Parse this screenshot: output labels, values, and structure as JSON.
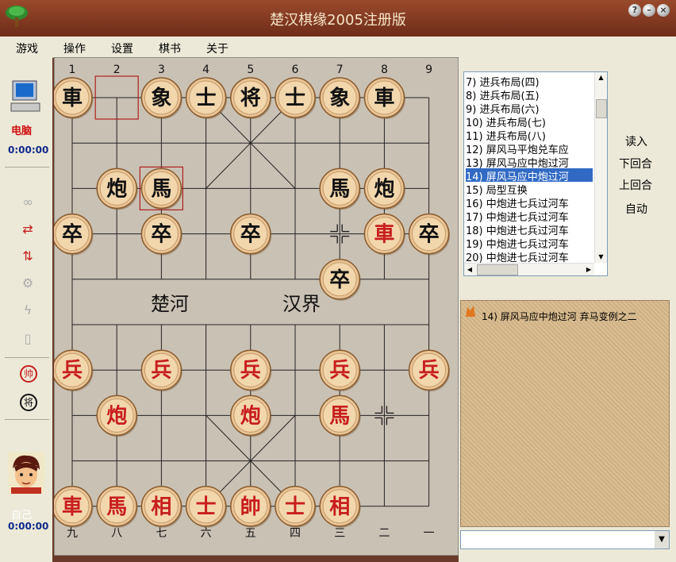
{
  "window": {
    "title": "楚汉棋缘2005注册版"
  },
  "menu": [
    "游戏",
    "操作",
    "设置",
    "棋书",
    "关于"
  ],
  "board": {
    "top_labels": [
      "1",
      "2",
      "3",
      "4",
      "5",
      "6",
      "7",
      "8",
      "9"
    ],
    "bottom_labels": [
      "九",
      "八",
      "七",
      "六",
      "五",
      "四",
      "三",
      "二",
      "一"
    ],
    "river_left": "楚河",
    "river_right": "汉界",
    "pieces": [
      {
        "char": "車",
        "side": "black",
        "col": 0,
        "row": 0
      },
      {
        "char": "象",
        "side": "black",
        "col": 2,
        "row": 0
      },
      {
        "char": "士",
        "side": "black",
        "col": 3,
        "row": 0
      },
      {
        "char": "将",
        "side": "black",
        "col": 4,
        "row": 0
      },
      {
        "char": "士",
        "side": "black",
        "col": 5,
        "row": 0
      },
      {
        "char": "象",
        "side": "black",
        "col": 6,
        "row": 0
      },
      {
        "char": "車",
        "side": "black",
        "col": 7,
        "row": 0
      },
      {
        "char": "炮",
        "side": "black",
        "col": 1,
        "row": 2
      },
      {
        "char": "馬",
        "side": "black",
        "col": 2,
        "row": 2
      },
      {
        "char": "馬",
        "side": "black",
        "col": 6,
        "row": 2
      },
      {
        "char": "炮",
        "side": "black",
        "col": 7,
        "row": 2
      },
      {
        "char": "卒",
        "side": "black",
        "col": 0,
        "row": 3
      },
      {
        "char": "卒",
        "side": "black",
        "col": 2,
        "row": 3
      },
      {
        "char": "卒",
        "side": "black",
        "col": 4,
        "row": 3
      },
      {
        "char": "車",
        "side": "red",
        "col": 7,
        "row": 3
      },
      {
        "char": "卒",
        "side": "black",
        "col": 8,
        "row": 3
      },
      {
        "char": "卒",
        "side": "black",
        "col": 6,
        "row": 4
      },
      {
        "char": "兵",
        "side": "red",
        "col": 0,
        "row": 6
      },
      {
        "char": "兵",
        "side": "red",
        "col": 2,
        "row": 6
      },
      {
        "char": "兵",
        "side": "red",
        "col": 4,
        "row": 6
      },
      {
        "char": "兵",
        "side": "red",
        "col": 6,
        "row": 6
      },
      {
        "char": "兵",
        "side": "red",
        "col": 8,
        "row": 6
      },
      {
        "char": "炮",
        "side": "red",
        "col": 1,
        "row": 7
      },
      {
        "char": "炮",
        "side": "red",
        "col": 4,
        "row": 7
      },
      {
        "char": "馬",
        "side": "red",
        "col": 6,
        "row": 7
      },
      {
        "char": "車",
        "side": "red",
        "col": 0,
        "row": 9
      },
      {
        "char": "馬",
        "side": "red",
        "col": 1,
        "row": 9
      },
      {
        "char": "相",
        "side": "red",
        "col": 2,
        "row": 9
      },
      {
        "char": "士",
        "side": "red",
        "col": 3,
        "row": 9
      },
      {
        "char": "帥",
        "side": "red",
        "col": 4,
        "row": 9
      },
      {
        "char": "士",
        "side": "red",
        "col": 5,
        "row": 9
      },
      {
        "char": "相",
        "side": "red",
        "col": 6,
        "row": 9
      }
    ],
    "last_move_squares": [
      {
        "col": 1,
        "row": 0
      },
      {
        "col": 2,
        "row": 2
      }
    ],
    "crosshair_marks": [
      {
        "col": 6,
        "row": 3
      },
      {
        "col": 7,
        "row": 7
      }
    ]
  },
  "left_panel": {
    "computer_label": "电脑",
    "computer_time": "0:00:00",
    "self_label": "自己",
    "self_time": "0:00:00",
    "badge_red": "帅",
    "badge_black": "将"
  },
  "opening_list": [
    "7) 进兵布局(四)",
    "8) 进兵布局(五)",
    "9) 进兵布局(六)",
    "10) 进兵布局(七)",
    "11) 进兵布局(八)",
    "12) 屏风马平炮兑车应",
    "13) 屏风马应中炮过河",
    "14) 屏风马应中炮过河",
    "15) 局型互换",
    "16) 中炮进七兵过河车",
    "17) 中炮进七兵过河车",
    "18) 中炮进七兵过河车",
    "19) 中炮进七兵过河车",
    "20) 中炮进七兵过河车"
  ],
  "selected_index": 7,
  "controls": [
    "读入",
    "下回合",
    "上回合",
    "自动"
  ],
  "notes": {
    "text": "14) 屏风马应中炮过河 弃马变例之二"
  },
  "colors": {
    "red_piece": "#c81e1e",
    "black_piece": "#111111",
    "selection": "#316ac5"
  }
}
